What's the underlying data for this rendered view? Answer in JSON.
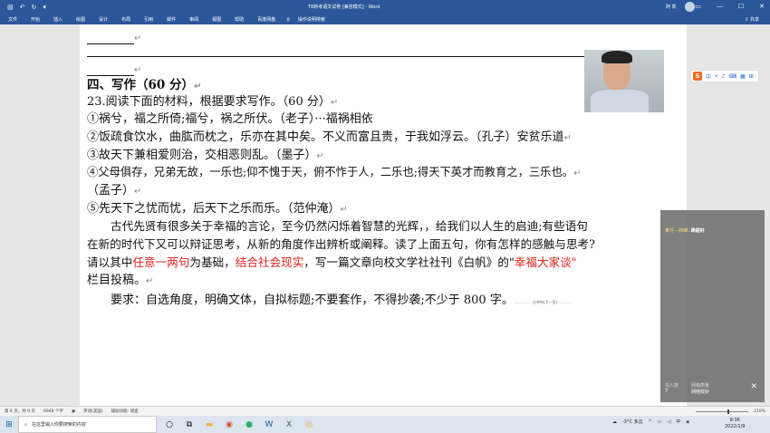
{
  "titlebar": {
    "title": "T8新考语文试卷 [兼容模式] - Word",
    "user": "阿 凯",
    "share": "共享"
  },
  "ribbon": {
    "tabs": [
      "文件",
      "开始",
      "插入",
      "绘图",
      "设计",
      "布局",
      "引用",
      "邮件",
      "审阅",
      "视图",
      "帮助",
      "百度网盘"
    ],
    "tell_me": "操作说明搜索"
  },
  "document": {
    "para_mark": "↵",
    "heading": "四、写作（60 分）",
    "q23": "23.阅读下面的材料，根据要求写作。（60 分）",
    "item1": "①祸兮，福之所倚;福兮，祸之所伏。（老子）···福祸相依",
    "item2": "②饭疏食饮水，曲肱而枕之，乐亦在其中矣。不义而富且贵，于我如浮云。（孔子）安贫乐道",
    "item3": "③故天下兼相爱则治，交相恶则乱。（墨子）",
    "item4a": "④父母俱存，兄弟无故，一乐也;仰不愧于天，俯不怍于人，二乐也;得天下英才而教育之，三乐也。",
    "item4b": "（孟子）",
    "item5": "⑤先天下之忧而忧，后天下之乐而乐。（范仲淹）",
    "p1": "古代先贤有很多关于幸福的言论，至今仍然闪烁着智慧的光辉，，给我们以人生的启迪;有些语句",
    "p2": "在新的时代下又可以辩证思考，从新的角度作出辨析或阐释。读了上面五句，你有怎样的感触与思考?",
    "p3_a": "请以其中",
    "p3_red1": "任意一两句",
    "p3_b": "为基础，",
    "p3_red2": "结合社会现实",
    "p3_c": "，写一篇文章向校文学社社刊《白帆》的\"",
    "p3_red3": "幸福大家谈",
    "p3_d": "\"",
    "p4": "栏目投稿。",
    "req": "要求：自选角度，明确文体，自拟标题;不要套作，不得抄袭;不少于 800 字。",
    "page_break": "分节符(下一页)"
  },
  "ime": {
    "logo": "S",
    "items": [
      "中",
      "•",
      "♪",
      "⌨",
      "▦",
      "⊞"
    ]
  },
  "chat": {
    "msg_user": "奉行---林峰:",
    "msg_text": "跪甜好",
    "viewers_label": "在人数",
    "viewers": "7",
    "score_label": "网络质量",
    "score": "网络较好"
  },
  "statusbar": {
    "page": "第 8 页，共 9 页",
    "words": "6948 个字",
    "lang": "英语(美国)",
    "access": "辅助功能: 调查",
    "zoom": "210%"
  },
  "taskbar": {
    "search_placeholder": "在这里输入你要搜索的内容",
    "weather": "-3°C 多云",
    "ime": "中",
    "time": "9:36",
    "date": "2022/1/9"
  }
}
